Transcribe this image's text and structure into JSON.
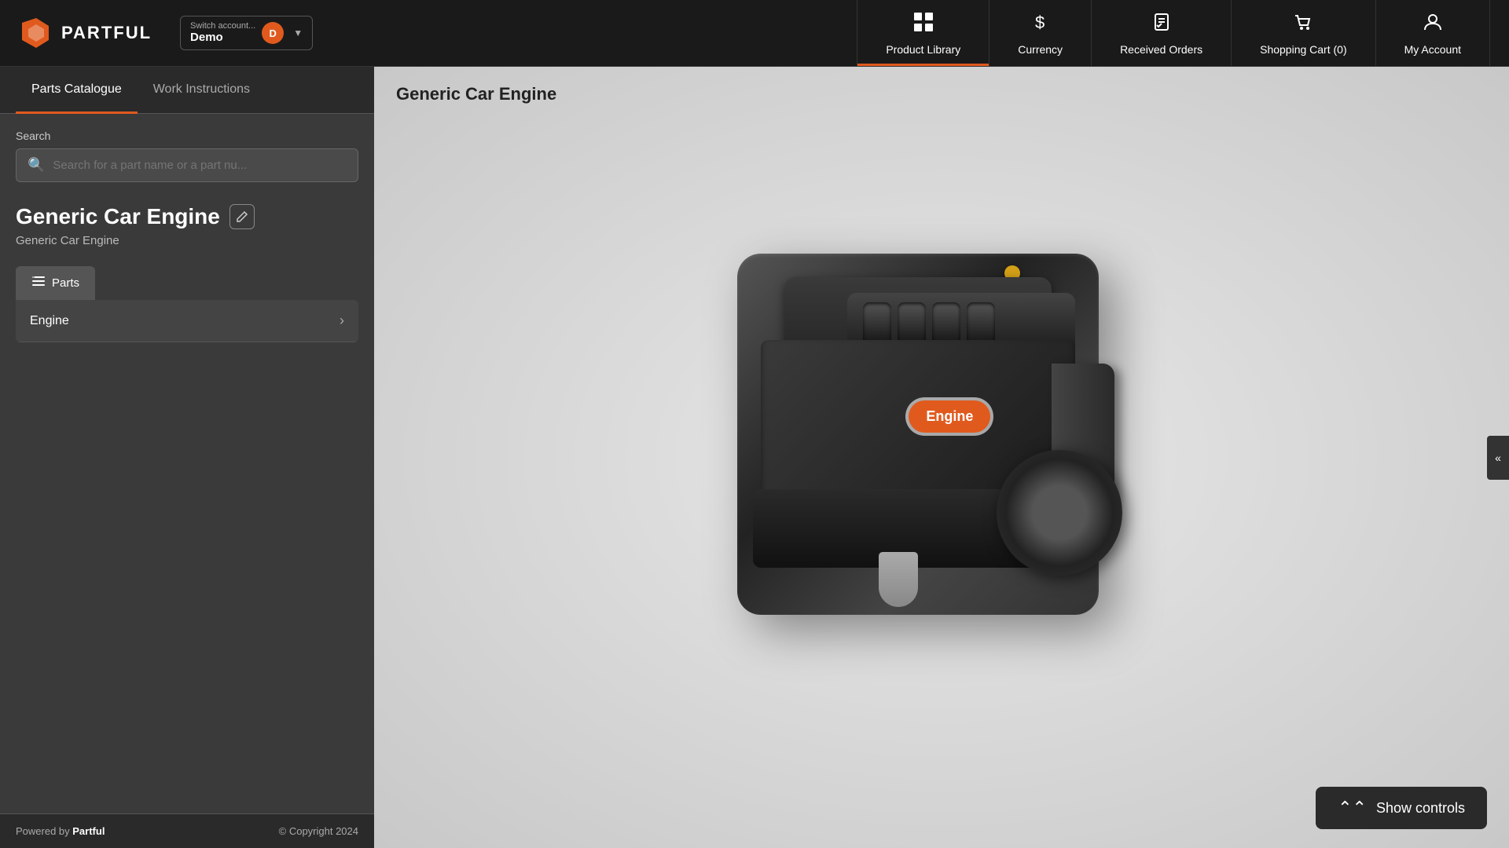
{
  "header": {
    "logo_text": "PARTFUL",
    "account_switcher_label": "Switch account...",
    "account_name": "Demo",
    "account_initial": "D",
    "nav_items": [
      {
        "id": "product-library",
        "label": "Product Library",
        "icon": "grid",
        "active": true,
        "badge": null
      },
      {
        "id": "currency",
        "label": "Currency",
        "icon": "dollar",
        "active": false,
        "badge": null
      },
      {
        "id": "received-orders",
        "label": "Received Orders",
        "icon": "checklist",
        "active": false,
        "badge": null
      },
      {
        "id": "shopping-cart",
        "label": "Shopping Cart (0)",
        "icon": "cart",
        "active": false,
        "badge": "0"
      },
      {
        "id": "my-account",
        "label": "My Account",
        "icon": "user",
        "active": false,
        "badge": null
      }
    ]
  },
  "sidebar": {
    "tabs": [
      {
        "id": "parts-catalogue",
        "label": "Parts Catalogue",
        "active": true
      },
      {
        "id": "work-instructions",
        "label": "Work Instructions",
        "active": false
      }
    ],
    "search": {
      "label": "Search",
      "placeholder": "Search for a part name or a part nu..."
    },
    "product": {
      "title": "Generic Car Engine",
      "subtitle": "Generic Car Engine",
      "edit_tooltip": "Edit"
    },
    "parts_tab": {
      "label": "Parts"
    },
    "parts": [
      {
        "name": "Engine"
      }
    ],
    "footer": {
      "powered_by": "Powered by ",
      "brand": "Partful",
      "copyright": "© Copyright 2024"
    }
  },
  "view": {
    "title": "Generic Car Engine",
    "engine_label": "Engine",
    "collapse_icon": "«",
    "show_controls_label": "Show controls"
  }
}
